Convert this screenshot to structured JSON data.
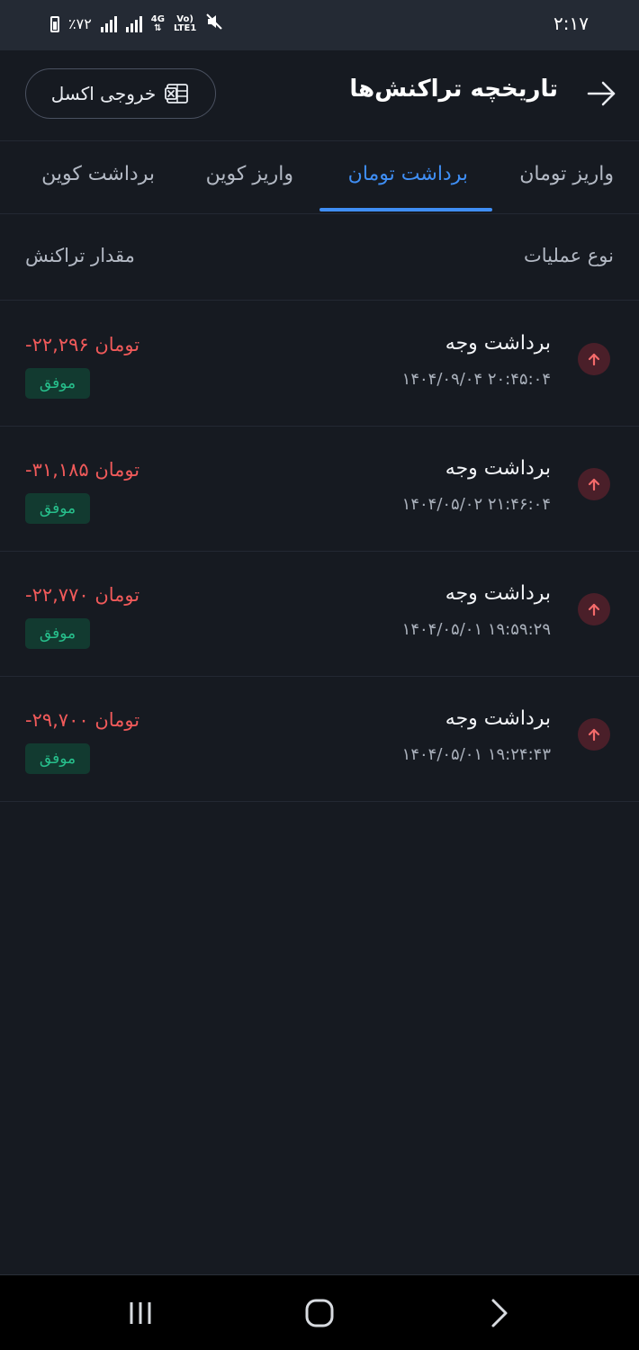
{
  "status_bar": {
    "time": "۲:۱۷",
    "battery": "٪۷۲",
    "network_top": "4G",
    "network_bottom": "",
    "volte_top": "Vo)",
    "volte_bottom": "LTE1"
  },
  "header": {
    "title": "تاریخچه تراکنش‌ها",
    "excel_label": "خروجی اکسل"
  },
  "tabs": [
    {
      "label": "واریز تومان",
      "active": false
    },
    {
      "label": "برداشت تومان",
      "active": true
    },
    {
      "label": "واریز کوین",
      "active": false
    },
    {
      "label": "برداشت کوین",
      "active": false
    }
  ],
  "columns": {
    "type": "نوع عملیات",
    "amount": "مقدار تراکنش"
  },
  "transactions": [
    {
      "title": "برداشت وجه",
      "datetime": "۱۴۰۴/۰۹/۰۴ ۲۰:۴۵:۰۴",
      "amount": "-۲۲,۲۹۶ تومان",
      "status": "موفق"
    },
    {
      "title": "برداشت وجه",
      "datetime": "۱۴۰۴/۰۵/۰۲ ۲۱:۴۶:۰۴",
      "amount": "-۳۱,۱۸۵ تومان",
      "status": "موفق"
    },
    {
      "title": "برداشت وجه",
      "datetime": "۱۴۰۴/۰۵/۰۱ ۱۹:۵۹:۲۹",
      "amount": "-۲۲,۷۷۰ تومان",
      "status": "موفق"
    },
    {
      "title": "برداشت وجه",
      "datetime": "۱۴۰۴/۰۵/۰۱ ۱۹:۲۴:۴۳",
      "amount": "-۲۹,۷۰۰ تومان",
      "status": "موفق"
    }
  ],
  "colors": {
    "background": "#161a21",
    "accent": "#3f8ef4",
    "negative": "#f05a5a",
    "success": "#27c08c"
  }
}
